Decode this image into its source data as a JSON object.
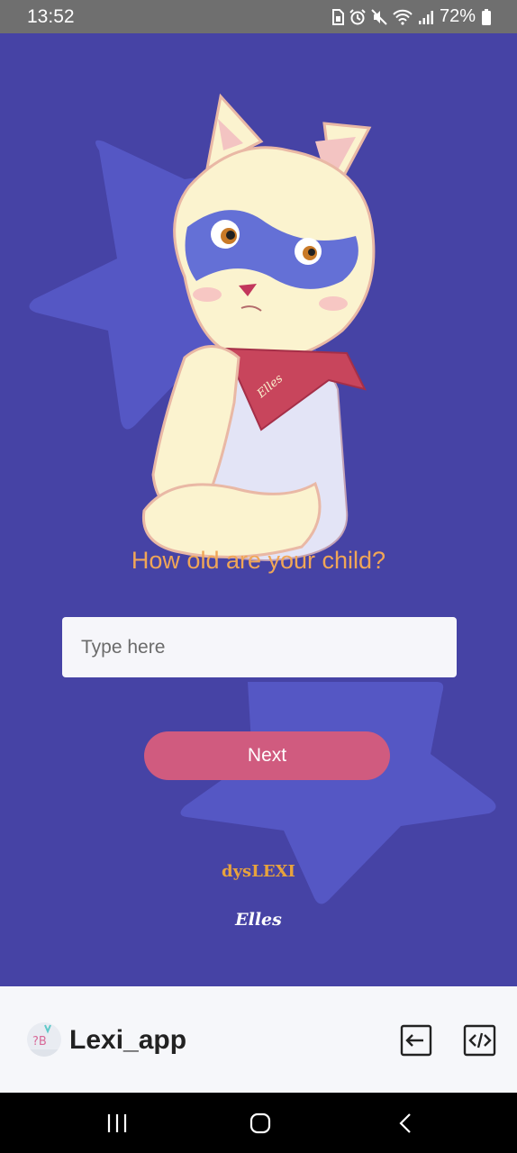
{
  "status_bar": {
    "time": "13:52",
    "battery": "72%",
    "icons": [
      "sim-icon",
      "alarm-icon",
      "mute-icon",
      "wifi-icon",
      "signal-icon",
      "battery-icon"
    ]
  },
  "onboarding": {
    "question": "How old are your child?",
    "input_placeholder": "Type here",
    "input_value": "",
    "next_label": "Next",
    "bandana_text": "Elles",
    "brand_text": "dysLEXI",
    "signature_text": "Elles"
  },
  "bottom_panel": {
    "app_name": "Lexi_app",
    "logo_letters": "?B"
  },
  "colors": {
    "background": "#4643a5",
    "star": "#5557c4",
    "question": "#f0a657",
    "next_button": "#d05b7f",
    "brand": "#e8a33d"
  },
  "nav_bar": {
    "icons": [
      "recents-icon",
      "home-icon",
      "back-icon"
    ]
  }
}
